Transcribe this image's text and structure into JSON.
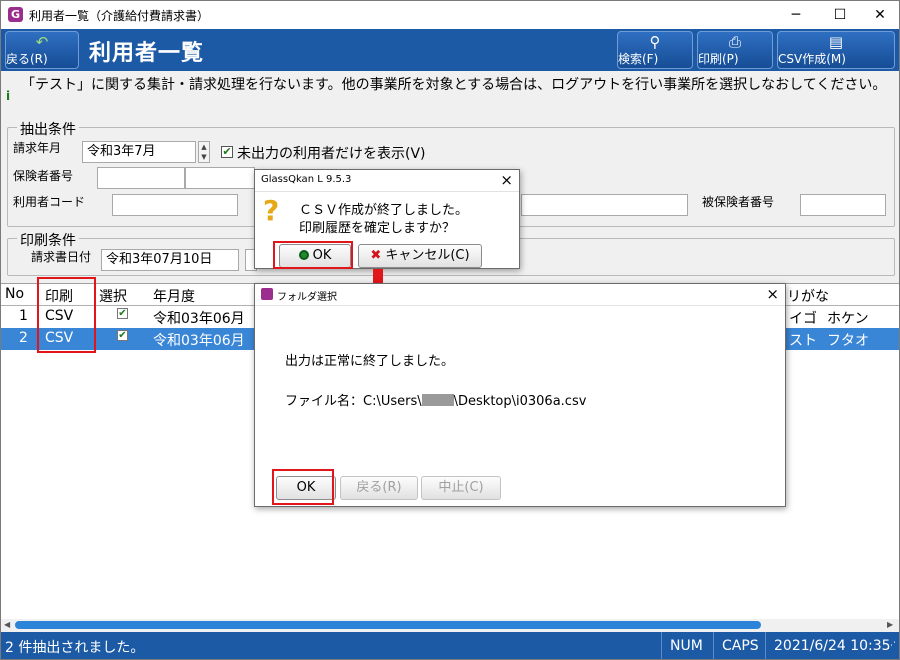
{
  "window": {
    "app_icon": "G",
    "title": "利用者一覧（介護給付費請求書）",
    "minimize": "─",
    "maximize": "☐",
    "close": "✕"
  },
  "toolbar": {
    "back_label": "戻る(R)",
    "page_title": "利用者一覧",
    "search_label": "検索(F)",
    "print_label": "印刷(P)",
    "csv_label": "CSV作成(M)"
  },
  "info": {
    "icon": "i",
    "message": "「テスト」に関する集計・請求処理を行ないます。他の事業所を対象とする場合は、ログアウトを行い事業所を選択しなおしてください。"
  },
  "extract": {
    "group_label": "抽出条件",
    "billing_month_label": "請求年月",
    "billing_month_value": "令和3年7月",
    "unoutput_only_label": "未出力の利用者だけを表示(V)",
    "unoutput_only_checked": "✔",
    "insurer_no_label": "保険者番号",
    "user_code_label": "利用者コード",
    "insured_no_label": "被保険者番号"
  },
  "print": {
    "group_label": "印刷条件",
    "invoice_date_label": "請求書日付",
    "invoice_date_value": "令和3年07月10日"
  },
  "grid": {
    "headers": {
      "no": "No",
      "print": "印刷",
      "select": "選択",
      "month": "年月度",
      "kana": "リがな"
    },
    "rows": [
      {
        "no": "1",
        "print": "CSV",
        "check": "✔",
        "month": "令和03年06月",
        "kana1": "イゴ",
        "kana2": "ホケン"
      },
      {
        "no": "2",
        "print": "CSV",
        "check": "✔",
        "month": "令和03年06月",
        "kana1": "スト",
        "kana2": "フタオ"
      }
    ]
  },
  "status": {
    "message": "2 件抽出されました。",
    "num": "NUM",
    "caps": "CAPS",
    "datetime": "2021/6/24 10:35"
  },
  "confirm_dialog": {
    "title": "GlassQkan L 9.5.3",
    "icon": "?",
    "line1": "ＣＳＶ作成が終了しました。",
    "line2": "印刷履歴を確定しますか？",
    "ok_label": "OK",
    "cancel_label": "キャンセル(C)"
  },
  "folder_dialog": {
    "title": "フォルダ選択",
    "message": "出力は正常に終了しました。",
    "file_prefix": "ファイル名：C:\\Users\\",
    "file_suffix": "\\Desktop\\i0306a.csv",
    "ok_label": "OK",
    "back_label": "戻る(R)",
    "abort_label": "中止(C)"
  },
  "colors": {
    "accent_blue": "#1c5aa6",
    "selection_blue": "#3a86d6",
    "annotation_red": "#e0161b"
  }
}
